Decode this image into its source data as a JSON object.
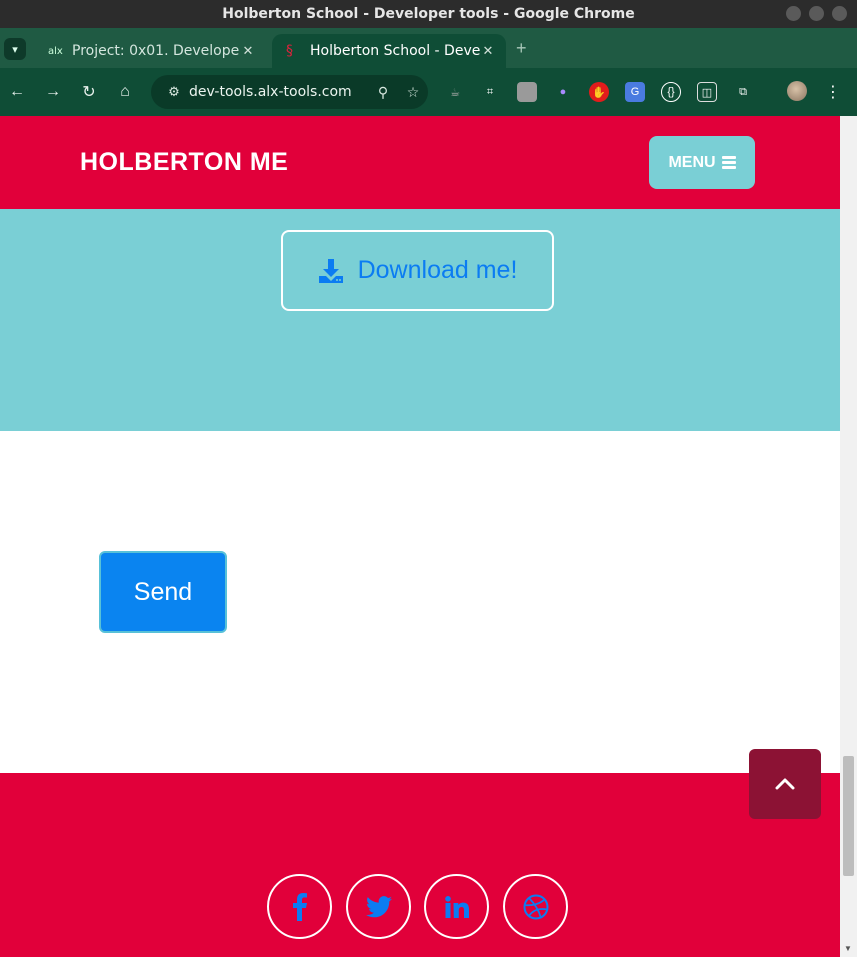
{
  "window": {
    "title": "Holberton School - Developer tools - Google Chrome"
  },
  "tabs": [
    {
      "label": "Project: 0x01. Developer",
      "favicon": "alx"
    },
    {
      "label": "Holberton School - Deve",
      "favicon": "§"
    }
  ],
  "toolbar": {
    "url": "dev-tools.alx-tools.com"
  },
  "page": {
    "brand": "HOLBERTON ME",
    "menu_label": "MENU",
    "download_label": "Download me!",
    "send_label": "Send"
  },
  "colors": {
    "brand_red": "#e1003a",
    "teal": "#7acfd5",
    "link_blue": "#0b7cf2",
    "back_to_top": "#8c1234"
  },
  "icons": [
    "download-icon",
    "facebook-icon",
    "twitter-icon",
    "linkedin-icon",
    "dribbble-icon",
    "chevron-up-icon"
  ]
}
